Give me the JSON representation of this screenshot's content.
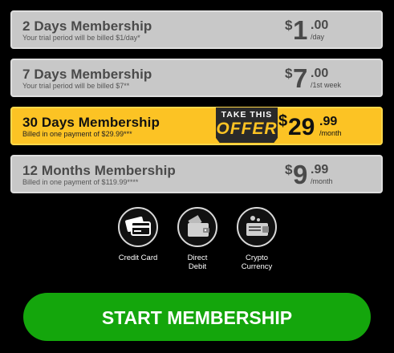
{
  "plans": [
    {
      "name": "2 Days Membership",
      "subtitle": "Your trial period will be billed $1/day*",
      "currency": "$",
      "price_main": "1",
      "price_cents": ".00",
      "period": "/day"
    },
    {
      "name": "7 Days Membership",
      "subtitle": "Your trial period will be billed $7**",
      "currency": "$",
      "price_main": "7",
      "price_cents": ".00",
      "period": "/1st week"
    },
    {
      "name": "30 Days Membership",
      "subtitle": "Billed in one payment of $29.99***",
      "currency": "$",
      "price_main": "29",
      "price_cents": ".99",
      "period": "/month",
      "badge_line1": "TAKE THIS",
      "badge_line2": "OFFER",
      "selected": true
    },
    {
      "name": "12 Months Membership",
      "subtitle": "Billed in one payment of $119.99****",
      "currency": "$",
      "price_main": "9",
      "price_cents": ".99",
      "period": "/month"
    }
  ],
  "payment_methods": [
    {
      "label": "Credit Card",
      "icon": "credit-card-icon"
    },
    {
      "label": "Direct\nDebit",
      "icon": "wallet-icon"
    },
    {
      "label": "Crypto\nCurrency",
      "icon": "crypto-wallet-icon"
    }
  ],
  "cta": {
    "label": "START MEMBERSHIP"
  },
  "colors": {
    "selected": "#fcc324",
    "plan": "#c8c8c8",
    "cta": "#14a60c",
    "background": "#000000"
  }
}
